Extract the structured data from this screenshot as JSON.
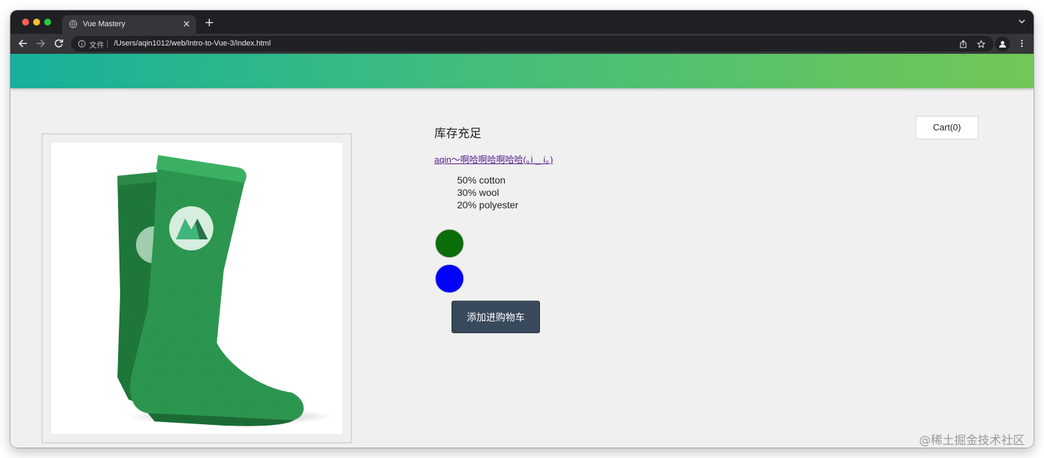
{
  "browser": {
    "tab_title": "Vue Mastery",
    "tab_close": "×",
    "new_tab": "+",
    "security_label": "文件",
    "url": "/Users/aqin1012/web/Intro-to-Vue-3/index.html"
  },
  "page": {
    "cart_label": "Cart(0)",
    "product_title": "库存充足",
    "product_link": "aqin～啊哈啊哈啊哈哈(｡ì _ í｡)",
    "details": [
      "50% cotton",
      "30% wool",
      "20% polyester"
    ],
    "variants": [
      {
        "name": "green",
        "color": "#0a6e0a"
      },
      {
        "name": "blue",
        "color": "#0000ff"
      }
    ],
    "add_button_label": "添加进购物车",
    "product_image_alt": "green socks"
  },
  "colors": {
    "nav_gradient_start": "#16b09a",
    "nav_gradient_end": "#72c756",
    "button_bg": "#39495c",
    "link_color": "#551a8b"
  },
  "watermark": "@稀土掘金技术社区"
}
